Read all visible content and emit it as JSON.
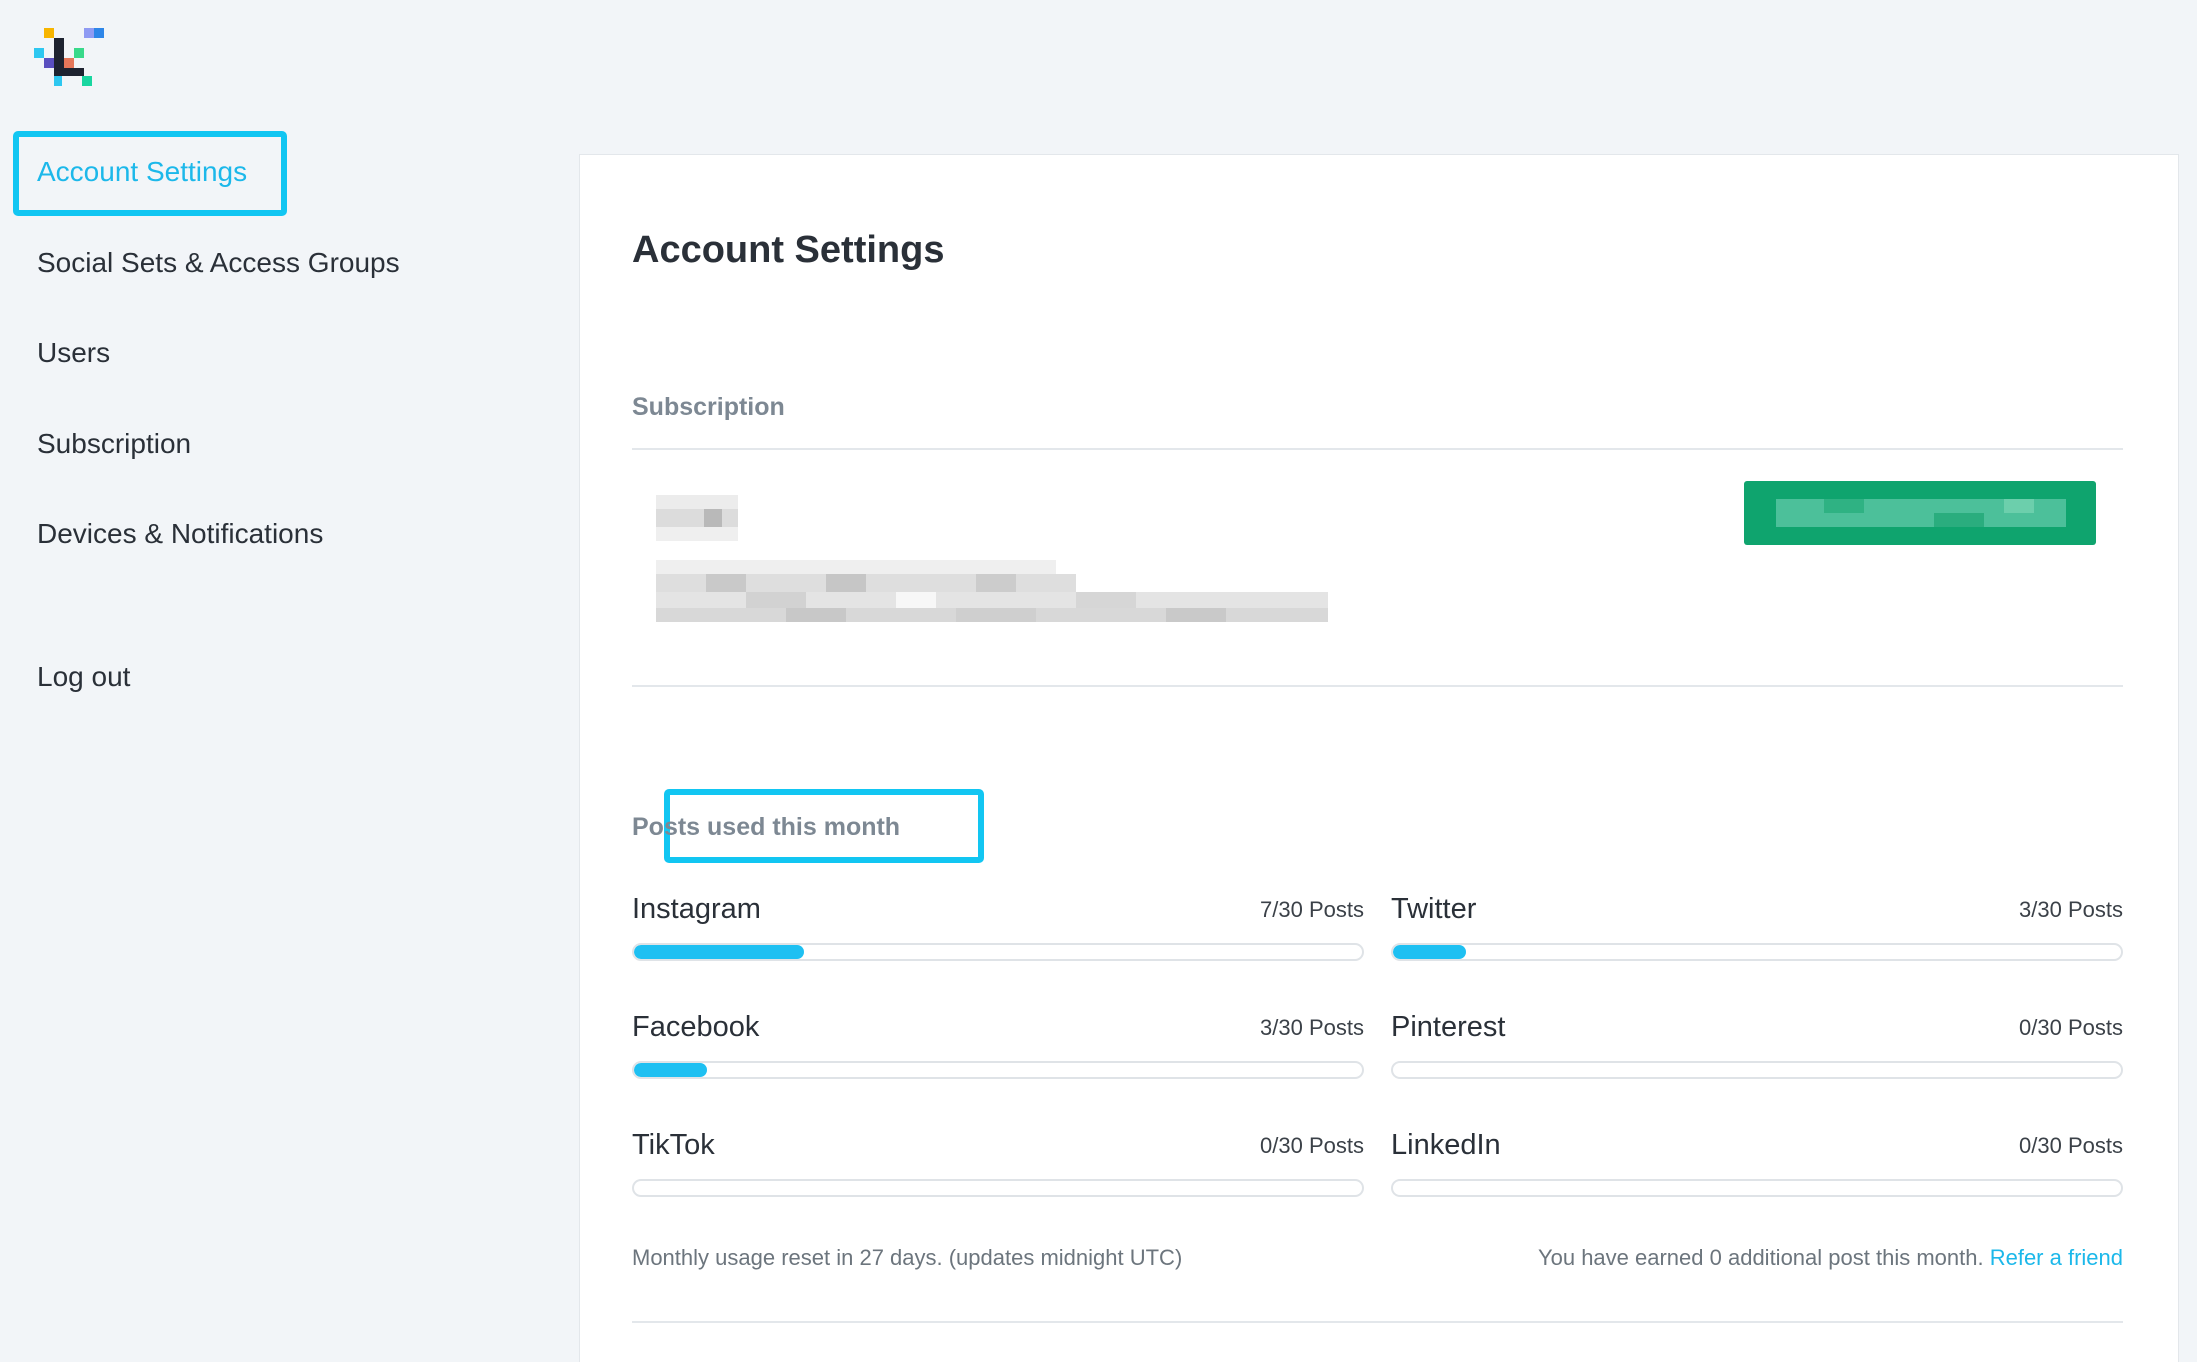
{
  "brand": {
    "logo_icon": "pixel-logo-icon",
    "accent": "#1cb8ea",
    "highlight": "#12c6f2",
    "progress": "#1ec0f2",
    "redacted_button": "#0fa46e"
  },
  "sidebar": {
    "items": [
      {
        "label": "Account Settings",
        "active": true
      },
      {
        "label": "Social Sets & Access Groups"
      },
      {
        "label": "Users"
      },
      {
        "label": "Subscription"
      },
      {
        "label": "Devices & Notifications"
      }
    ],
    "logout_label": "Log out"
  },
  "main": {
    "title": "Account Settings",
    "subscription": {
      "label": "Subscription"
    },
    "posts": {
      "label": "Posts used this month",
      "networks": [
        {
          "name": "Instagram",
          "count": "7/30 Posts",
          "used": 7,
          "limit": 30
        },
        {
          "name": "Twitter",
          "count": "3/30 Posts",
          "used": 3,
          "limit": 30
        },
        {
          "name": "Facebook",
          "count": "3/30 Posts",
          "used": 3,
          "limit": 30
        },
        {
          "name": "Pinterest",
          "count": "0/30 Posts",
          "used": 0,
          "limit": 30
        },
        {
          "name": "TikTok",
          "count": "0/30 Posts",
          "used": 0,
          "limit": 30
        },
        {
          "name": "LinkedIn",
          "count": "0/30 Posts",
          "used": 0,
          "limit": 30
        }
      ],
      "reset_note": "Monthly usage reset in 27 days. (updates midnight UTC)",
      "earned_note": "You have earned 0 additional post this month.",
      "refer_link": "Refer a friend"
    }
  }
}
